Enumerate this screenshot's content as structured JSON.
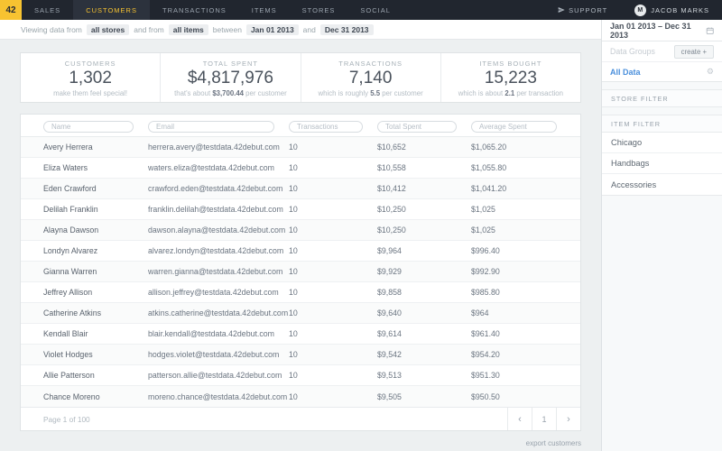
{
  "colors": {
    "accent_yellow": "#F7C331",
    "link_blue": "#4A8FDC",
    "nav_bg": "#21262F"
  },
  "nav": {
    "logo": "42",
    "tabs": [
      {
        "label": "SALES"
      },
      {
        "label": "CUSTOMERS",
        "active": true
      },
      {
        "label": "TRANSACTIONS"
      },
      {
        "label": "ITEMS"
      },
      {
        "label": "STORES"
      },
      {
        "label": "SOCIAL"
      }
    ],
    "support_label": "SUPPORT",
    "user_name": "JACOB MARKS",
    "avatar_monogram": "M"
  },
  "filter_bar": {
    "prefix": "Viewing data from",
    "stores_chip": "all stores",
    "mid1": "and from",
    "items_chip": "all items",
    "mid2": "between",
    "start_chip": "Jan 01 2013",
    "mid3": "and",
    "end_chip": "Dec 31 2013"
  },
  "stats": [
    {
      "label": "CUSTOMERS",
      "value": "1,302",
      "note_pre": "make them feel special!",
      "note_bold": "",
      "note_post": ""
    },
    {
      "label": "TOTAL SPENT",
      "value": "$4,817,976",
      "note_pre": "that's about ",
      "note_bold": "$3,700.44",
      "note_post": " per customer"
    },
    {
      "label": "TRANSACTIONS",
      "value": "7,140",
      "note_pre": "which is roughly ",
      "note_bold": "5.5",
      "note_post": " per customer"
    },
    {
      "label": "ITEMS BOUGHT",
      "value": "15,223",
      "note_pre": "which is about ",
      "note_bold": "2.1",
      "note_post": " per transaction"
    }
  ],
  "table": {
    "filters": [
      {
        "placeholder": "Name"
      },
      {
        "placeholder": "Email"
      },
      {
        "placeholder": "Transactions"
      },
      {
        "placeholder": "Total Spent"
      },
      {
        "placeholder": "Average Spent"
      }
    ],
    "rows": [
      {
        "name": "Avery Herrera",
        "email": "herrera.avery@testdata.42debut.com",
        "transactions": "10",
        "total": "$10,652",
        "average": "$1,065.20"
      },
      {
        "name": "Eliza Waters",
        "email": "waters.eliza@testdata.42debut.com",
        "transactions": "10",
        "total": "$10,558",
        "average": "$1,055.80"
      },
      {
        "name": "Eden Crawford",
        "email": "crawford.eden@testdata.42debut.com",
        "transactions": "10",
        "total": "$10,412",
        "average": "$1,041.20"
      },
      {
        "name": "Delilah Franklin",
        "email": "franklin.delilah@testdata.42debut.com",
        "transactions": "10",
        "total": "$10,250",
        "average": "$1,025"
      },
      {
        "name": "Alayna Dawson",
        "email": "dawson.alayna@testdata.42debut.com",
        "transactions": "10",
        "total": "$10,250",
        "average": "$1,025"
      },
      {
        "name": "Londyn Alvarez",
        "email": "alvarez.londyn@testdata.42debut.com",
        "transactions": "10",
        "total": "$9,964",
        "average": "$996.40"
      },
      {
        "name": "Gianna Warren",
        "email": "warren.gianna@testdata.42debut.com",
        "transactions": "10",
        "total": "$9,929",
        "average": "$992.90"
      },
      {
        "name": "Jeffrey Allison",
        "email": "allison.jeffrey@testdata.42debut.com",
        "transactions": "10",
        "total": "$9,858",
        "average": "$985.80"
      },
      {
        "name": "Catherine Atkins",
        "email": "atkins.catherine@testdata.42debut.com",
        "transactions": "10",
        "total": "$9,640",
        "average": "$964"
      },
      {
        "name": "Kendall Blair",
        "email": "blair.kendall@testdata.42debut.com",
        "transactions": "10",
        "total": "$9,614",
        "average": "$961.40"
      },
      {
        "name": "Violet Hodges",
        "email": "hodges.violet@testdata.42debut.com",
        "transactions": "10",
        "total": "$9,542",
        "average": "$954.20"
      },
      {
        "name": "Allie Patterson",
        "email": "patterson.allie@testdata.42debut.com",
        "transactions": "10",
        "total": "$9,513",
        "average": "$951.30"
      },
      {
        "name": "Chance Moreno",
        "email": "moreno.chance@testdata.42debut.com",
        "transactions": "10",
        "total": "$9,505",
        "average": "$950.50"
      }
    ]
  },
  "pagination": {
    "status": "Page 1 of 100",
    "prev": "‹",
    "page": "1",
    "next": "›"
  },
  "export_label": "export customers",
  "sidebar": {
    "date_range": "Jan 01 2013 – Dec 31 2013",
    "data_groups_label": "Data Groups",
    "create_label": "create +",
    "groups": [
      {
        "label": "All Data",
        "active": true
      }
    ],
    "gear_glyph": "⚙",
    "store_filter_label": "STORE FILTER",
    "item_filter_label": "ITEM FILTER",
    "filters": [
      "Chicago",
      "Handbags",
      "Accessories"
    ]
  }
}
